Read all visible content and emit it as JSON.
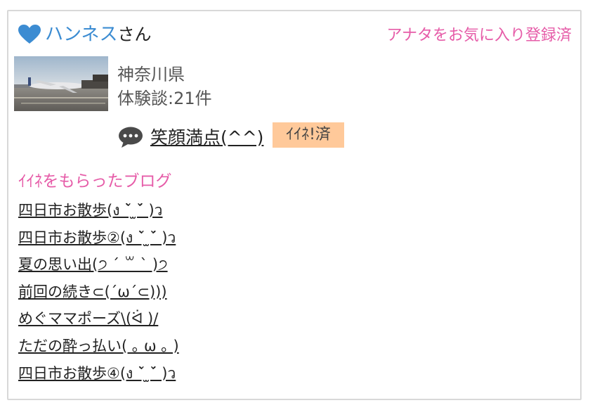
{
  "header": {
    "user_name": "ハンネス",
    "honorific": "さん",
    "favorite_status": "アナタをお気に入り登録済"
  },
  "profile": {
    "prefecture": "神奈川県",
    "experience_count": "体験談:21件"
  },
  "comment": {
    "text": "笑顔満点(^^)",
    "badge": "ｲｲﾈ!済"
  },
  "blogs": {
    "title": "ｲｲﾈをもらったブログ",
    "items": [
      "四日市お散歩(ง ˘̀ ̫˘́ )ว",
      "四日市お散歩②(ง ˘̀ ̫˘́ )ว",
      "夏の思い出(੭ ´ ꒳ ` )੭",
      "前回の続き⊂(´ω´⊂)))",
      "めぐママポーズ\\(ᐛ )/",
      "ただの酔っ払い( ｡ ω ｡ )",
      "四日市お散歩④(ง ˘̀ ̫˘́ )ว"
    ]
  },
  "colors": {
    "accent_pink": "#e65ca8",
    "name_blue": "#3c8cd2",
    "heart_blue": "#3c8cd2",
    "badge_bg": "#ffc99a",
    "bubble_icon": "#4a4a4a"
  },
  "icons": [
    "heart-icon",
    "speech-bubble-icon",
    "airplane-photo"
  ]
}
